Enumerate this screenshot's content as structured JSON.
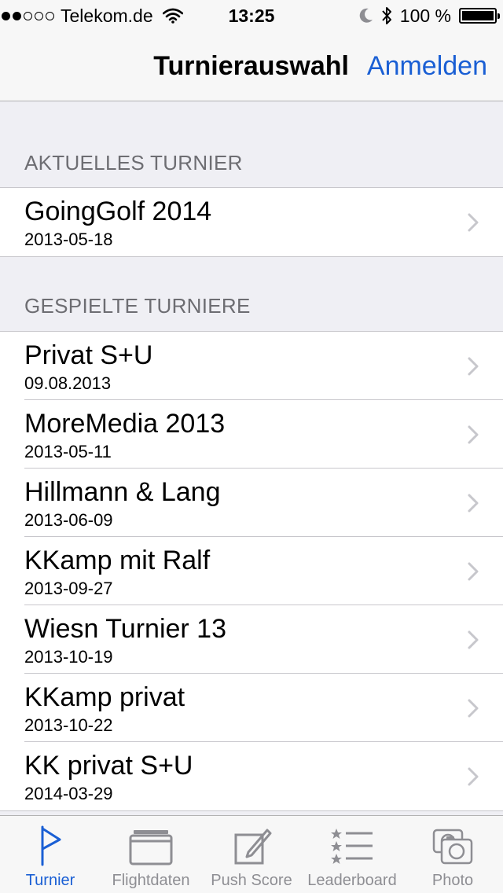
{
  "status_bar": {
    "carrier": "Telekom.de",
    "time": "13:25",
    "battery": "100 %",
    "signal_filled": 2,
    "signal_total": 5
  },
  "nav": {
    "title": "Turnierauswahl",
    "login": "Anmelden"
  },
  "current_section": {
    "header": "AKTUELLES TURNIER",
    "items": [
      {
        "name": "GoingGolf 2014",
        "date": "2013-05-18"
      }
    ]
  },
  "played_section": {
    "header": "GESPIELTE TURNIERE",
    "items": [
      {
        "name": "Privat S+U",
        "date": "09.08.2013"
      },
      {
        "name": "MoreMedia 2013",
        "date": "2013-05-11"
      },
      {
        "name": "Hillmann & Lang",
        "date": "2013-06-09"
      },
      {
        "name": "KKamp mit Ralf",
        "date": "2013-09-27"
      },
      {
        "name": "Wiesn Turnier 13",
        "date": "2013-10-19"
      },
      {
        "name": "KKamp privat",
        "date": "2013-10-22"
      },
      {
        "name": "KK privat S+U",
        "date": "2014-03-29"
      }
    ]
  },
  "tabbar": {
    "tabs": [
      {
        "label": "Turnier",
        "icon": "flag-icon",
        "active": true
      },
      {
        "label": "Flightdaten",
        "icon": "flight-data-icon",
        "active": false
      },
      {
        "label": "Push Score",
        "icon": "edit-score-icon",
        "active": false
      },
      {
        "label": "Leaderboard",
        "icon": "leaderboard-icon",
        "active": false
      },
      {
        "label": "Photo",
        "icon": "camera-icon",
        "active": false
      }
    ]
  },
  "colors": {
    "accent": "#1a5fd4",
    "inactive": "#8e8e93",
    "background": "#efeff4"
  }
}
